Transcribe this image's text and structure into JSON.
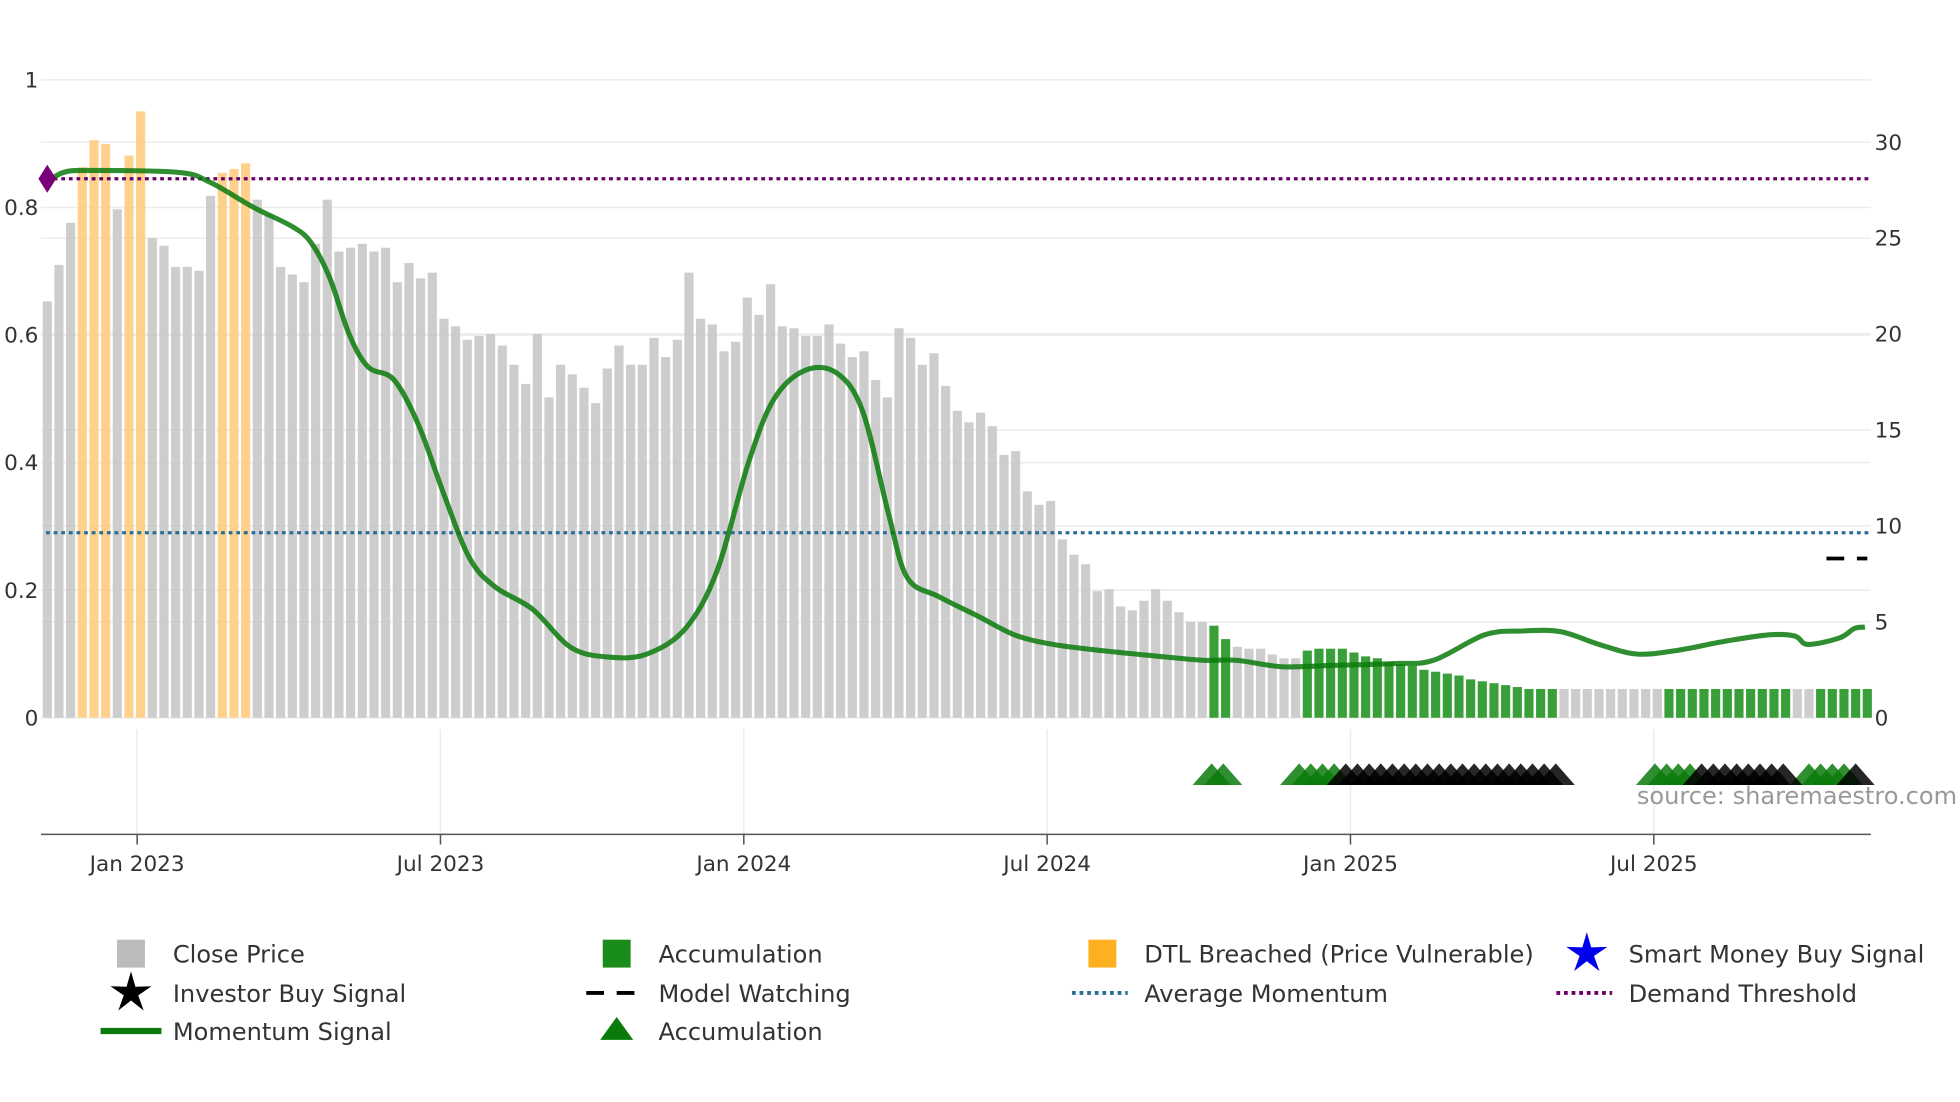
{
  "chart_data": {
    "type": "bar",
    "title": "",
    "x_unit": "weeks since first bar (weekly bars, ~Nov 2022 to Nov 2025)",
    "x_ticks": [
      {
        "label": "Jan 2023",
        "week": 7.7
      },
      {
        "label": "Jul 2023",
        "week": 33.7
      },
      {
        "label": "Jan 2024",
        "week": 59.7
      },
      {
        "label": "Jul 2024",
        "week": 85.7
      },
      {
        "label": "Jan 2025",
        "week": 111.7
      },
      {
        "label": "Jul 2025",
        "week": 137.7
      }
    ],
    "left_axis": {
      "ylim": [
        0,
        1
      ],
      "ticks": [
        "0",
        "0.2",
        "0.4",
        "0.6",
        "0.8",
        "1"
      ],
      "tick_values": [
        0,
        0.2,
        0.4,
        0.6,
        0.8,
        1
      ]
    },
    "right_axis": {
      "ylim": [
        0,
        30
      ],
      "ticks": [
        "0",
        "5",
        "10",
        "15",
        "20",
        "25",
        "30"
      ],
      "tick_values": [
        0,
        5,
        10,
        15,
        20,
        25,
        30
      ]
    },
    "close_price": [
      21.7,
      23.6,
      25.8,
      28.7,
      30.1,
      29.9,
      26.5,
      29.3,
      31.6,
      25.0,
      24.6,
      23.5,
      23.5,
      23.3,
      27.2,
      28.4,
      28.6,
      28.9,
      27.0,
      26.2,
      23.5,
      23.1,
      22.7,
      24.7,
      27.0,
      24.3,
      24.5,
      24.7,
      24.3,
      24.5,
      22.7,
      23.7,
      22.9,
      23.2,
      20.8,
      20.4,
      19.7,
      19.9,
      20.0,
      19.4,
      18.4,
      17.4,
      20.0,
      16.7,
      18.4,
      17.9,
      17.2,
      16.4,
      18.2,
      19.4,
      18.4,
      18.4,
      19.8,
      18.8,
      19.7,
      23.2,
      20.8,
      20.5,
      19.1,
      19.6,
      21.9,
      21.0,
      22.6,
      20.4,
      20.3,
      19.9,
      19.9,
      20.5,
      19.5,
      18.8,
      19.1,
      17.6,
      16.7,
      20.3,
      19.8,
      18.4,
      19.0,
      17.3,
      16.0,
      15.4,
      15.9,
      15.2,
      13.7,
      13.9,
      11.8,
      11.1,
      11.3,
      9.3,
      8.5,
      8.0,
      6.6,
      6.7,
      5.8,
      5.6,
      6.1,
      6.7,
      6.1,
      5.5,
      5.0,
      5.0,
      4.8,
      4.1,
      3.7,
      3.6,
      3.6,
      3.3,
      3.1,
      3.1,
      3.5,
      3.6,
      3.6,
      3.6,
      3.4,
      3.2,
      3.1,
      2.9,
      2.8,
      2.7,
      2.5,
      2.4,
      2.3,
      2.2,
      2.0,
      1.9,
      1.8,
      1.7,
      1.6,
      1.5,
      1.5,
      1.5,
      1.5,
      1.5,
      1.5,
      1.5,
      1.5,
      1.5,
      1.5,
      1.5,
      1.5,
      1.5,
      1.5,
      1.5,
      1.5,
      1.5,
      1.5,
      1.5,
      1.5,
      1.5,
      1.5,
      1.5,
      1.5,
      1.5,
      1.5,
      1.5,
      1.5,
      1.5,
      1.5
    ],
    "dtl_breached_weeks": [
      3,
      4,
      5,
      7,
      8,
      15,
      16,
      17
    ],
    "accumulation_bar_weeks": [
      100,
      101,
      108,
      109,
      110,
      111,
      112,
      113,
      114,
      115,
      116,
      117,
      118,
      119,
      120,
      121,
      122,
      123,
      124,
      125,
      126,
      127,
      128,
      129,
      139,
      140,
      141,
      142,
      143,
      144,
      145,
      146,
      147,
      148,
      149,
      152,
      153,
      154,
      155,
      156
    ],
    "momentum_signal": [
      [
        0,
        0.84
      ],
      [
        1.4,
        0.855
      ],
      [
        3.6,
        0.858
      ],
      [
        11.2,
        0.855
      ],
      [
        13.9,
        0.84
      ],
      [
        17.7,
        0.8
      ],
      [
        21,
        0.77
      ],
      [
        22.6,
        0.745
      ],
      [
        24.2,
        0.69
      ],
      [
        25.9,
        0.6
      ],
      [
        27.5,
        0.55
      ],
      [
        29.7,
        0.53
      ],
      [
        31.8,
        0.46
      ],
      [
        34,
        0.35
      ],
      [
        36.2,
        0.25
      ],
      [
        38.4,
        0.205
      ],
      [
        41.6,
        0.17
      ],
      [
        44.9,
        0.11
      ],
      [
        48.2,
        0.095
      ],
      [
        51.4,
        0.1
      ],
      [
        54.7,
        0.14
      ],
      [
        57.4,
        0.23
      ],
      [
        60.1,
        0.4
      ],
      [
        62.3,
        0.5
      ],
      [
        65,
        0.545
      ],
      [
        67.7,
        0.54
      ],
      [
        69.9,
        0.48
      ],
      [
        72.1,
        0.32
      ],
      [
        73.7,
        0.22
      ],
      [
        76.4,
        0.19
      ],
      [
        79.7,
        0.16
      ],
      [
        82.9,
        0.13
      ],
      [
        86.2,
        0.115
      ],
      [
        90.5,
        0.105
      ],
      [
        96,
        0.095
      ],
      [
        99.2,
        0.09
      ],
      [
        102,
        0.09
      ],
      [
        105.8,
        0.08
      ],
      [
        110.1,
        0.082
      ],
      [
        115.5,
        0.085
      ],
      [
        118.8,
        0.09
      ],
      [
        123.2,
        0.13
      ],
      [
        126.4,
        0.136
      ],
      [
        129.7,
        0.135
      ],
      [
        133,
        0.115
      ],
      [
        136.2,
        0.1
      ],
      [
        139.5,
        0.105
      ],
      [
        143.8,
        0.12
      ],
      [
        147.6,
        0.13
      ],
      [
        149.8,
        0.128
      ],
      [
        150.9,
        0.115
      ],
      [
        153.6,
        0.125
      ],
      [
        154.9,
        0.14
      ],
      [
        155.8,
        0.142
      ]
    ],
    "average_momentum": 0.29,
    "demand_threshold": 0.845,
    "model_watching": {
      "price": 8.3,
      "weeks": [
        152.5,
        156
      ]
    },
    "start_marker_value": 0.845,
    "accumulation_markers_weeks": [
      99.8,
      100.8,
      107.3,
      108.3,
      109.3,
      110.3,
      137.8,
      138.8,
      139.8,
      140.8,
      151,
      152,
      153,
      154
    ],
    "investor_buy_markers_weeks": [
      111.3,
      112.3,
      113.3,
      114.3,
      115.3,
      116.3,
      117.3,
      118.3,
      119.3,
      120.3,
      121.3,
      122.3,
      123.3,
      124.3,
      125.3,
      126.3,
      127.3,
      128.3,
      129.3,
      141.8,
      142.8,
      143.8,
      144.8,
      145.8,
      146.8,
      147.8,
      148.8,
      155
    ],
    "source": "source: sharemaestro.com",
    "legend_position": "bottom",
    "legend": [
      {
        "label": "Close Price",
        "symbol": "square",
        "color": "#bbbbbb"
      },
      {
        "label": "Accumulation",
        "symbol": "square",
        "color": "#1a8c1a"
      },
      {
        "label": "DTL Breached (Price Vulnerable)",
        "symbol": "square",
        "color": "#ffb020"
      },
      {
        "label": "Smart Money Buy Signal",
        "symbol": "star",
        "color": "#0000ee"
      },
      {
        "label": "Investor Buy Signal",
        "symbol": "star",
        "color": "#000000"
      },
      {
        "label": "Model Watching",
        "symbol": "dash",
        "color": "#000000"
      },
      {
        "label": "Average Momentum",
        "symbol": "dot",
        "color": "#2a6f97"
      },
      {
        "label": "Demand Threshold",
        "symbol": "dot",
        "color": "#6a006a"
      },
      {
        "label": "Momentum Signal",
        "symbol": "line",
        "color": "#0a7a0a"
      },
      {
        "label": "Accumulation",
        "symbol": "triangle",
        "color": "#0a7a0a"
      }
    ],
    "colors": {
      "price": "#c8c8c8",
      "dtl": "#ffcc80",
      "accum": "#2e9a2e",
      "momentum": "#0a7a0a",
      "avg": "#2a6f97",
      "demand": "#6a006a",
      "grid": "#ececec"
    }
  }
}
